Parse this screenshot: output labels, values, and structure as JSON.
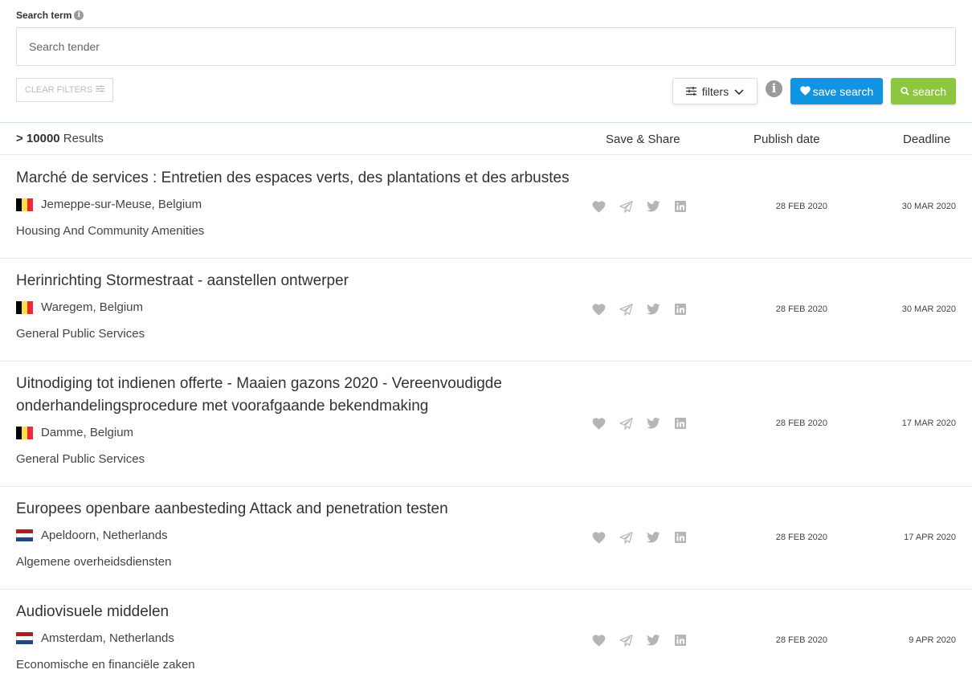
{
  "search": {
    "label": "Search term",
    "info_glyph": "i",
    "placeholder": "Search tender",
    "value": ""
  },
  "toolbar": {
    "clear_filters": "CLEAR FILTERS",
    "filters": "filters",
    "info_glyph": "i",
    "save_search": "save search",
    "search": "search"
  },
  "colors": {
    "save_search": "#1194e2",
    "search": "#8dc63f",
    "icon_gray": "#b5b5b5"
  },
  "results": {
    "count_prefix": "> 10000",
    "count_suffix": " Results",
    "headers": {
      "save_share": "Save & Share",
      "publish_date": "Publish date",
      "deadline": "Deadline"
    }
  },
  "tenders": [
    {
      "title": "Marché de services : Entretien des espaces verts, des plantations et des arbustes",
      "flag": "belgium",
      "location": "Jemeppe-sur-Meuse, Belgium",
      "category": "Housing And Community Amenities",
      "publish_date": "28 FEB 2020",
      "deadline": "30 MAR 2020"
    },
    {
      "title": "Herinrichting Stormestraat - aanstellen ontwerper",
      "flag": "belgium",
      "location": "Waregem, Belgium",
      "category": "General Public Services",
      "publish_date": "28 FEB 2020",
      "deadline": "30 MAR 2020"
    },
    {
      "title": "Uitnodiging tot indienen offerte - Maaien gazons 2020 - Vereenvoudigde onderhandelingsprocedure met voorafgaande bekendmaking",
      "flag": "belgium",
      "location": "Damme, Belgium",
      "category": "General Public Services",
      "publish_date": "28 FEB 2020",
      "deadline": "17 MAR 2020"
    },
    {
      "title": "Europees openbare aanbesteding Attack and penetration testen",
      "flag": "netherlands",
      "location": "Apeldoorn, Netherlands",
      "category": "Algemene overheidsdiensten",
      "publish_date": "28 FEB 2020",
      "deadline": "17 APR 2020"
    },
    {
      "title": "Audiovisuele middelen",
      "flag": "netherlands",
      "location": "Amsterdam, Netherlands",
      "category": "Economische en financiële zaken",
      "publish_date": "28 FEB 2020",
      "deadline": "9 APR 2020"
    }
  ]
}
